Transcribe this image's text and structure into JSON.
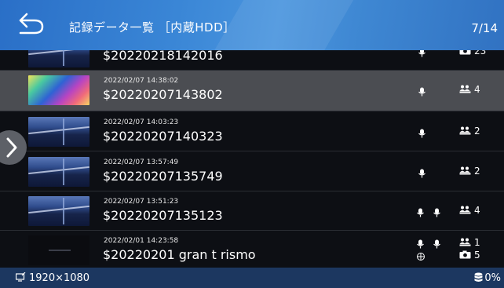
{
  "header": {
    "title": "記録データ一覧 ［内蔵HDD］",
    "page_indicator": "7/14",
    "back_icon": "return-arrow-icon"
  },
  "list": {
    "items": [
      {
        "date": "",
        "name": "$20220218142016",
        "thumbnail": "bridge-night",
        "mic_icons": 1,
        "extra_icon": "",
        "metrics": [
          {
            "icon": "camera-icon",
            "value": "23"
          }
        ]
      },
      {
        "date": "2022/02/07 14:38:02",
        "name": "$20220207143802",
        "thumbnail": "colorful",
        "selected": true,
        "mic_icons": 1,
        "extra_icon": "",
        "metrics": [
          {
            "icon": "people-icon",
            "value": "4"
          }
        ]
      },
      {
        "date": "2022/02/07 14:03:23",
        "name": "$20220207140323",
        "thumbnail": "bridge-night",
        "mic_icons": 1,
        "extra_icon": "",
        "metrics": [
          {
            "icon": "people-icon",
            "value": "2"
          }
        ]
      },
      {
        "date": "2022/02/07 13:57:49",
        "name": "$20220207135749",
        "thumbnail": "bridge-night",
        "mic_icons": 1,
        "extra_icon": "",
        "metrics": [
          {
            "icon": "people-icon",
            "value": "2"
          }
        ]
      },
      {
        "date": "2022/02/07 13:51:23",
        "name": "$20220207135123",
        "thumbnail": "bridge-night",
        "mic_icons": 2,
        "extra_icon": "",
        "metrics": [
          {
            "icon": "people-icon",
            "value": "4"
          }
        ]
      },
      {
        "date": "2022/02/01 14:23:58",
        "name": "$20220201 gran t rismo",
        "thumbnail": "dark",
        "mic_icons": 2,
        "extra_icon": "anchor-icon",
        "metrics": [
          {
            "icon": "people-icon",
            "value": "1"
          },
          {
            "icon": "camera-icon",
            "value": "5"
          }
        ]
      }
    ]
  },
  "footer": {
    "resolution": "1920×1080",
    "resolution_icon": "screen-resolution-icon",
    "storage": "0%",
    "storage_icon": "database-icon"
  },
  "side": {
    "expand_icon": "chevron-right-icon"
  },
  "colors": {
    "header_start": "#2a6fc7",
    "header_end": "#3172c2",
    "selected_row": "#4b4d52",
    "footer": "#1c3760",
    "background": "#0d0f14"
  }
}
